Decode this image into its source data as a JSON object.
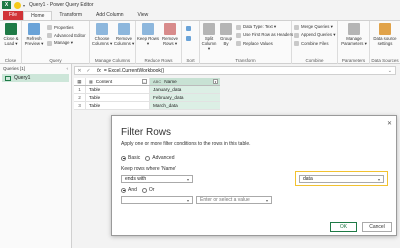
{
  "window": {
    "title": "Query1 - Power Query Editor",
    "app_icon": "X"
  },
  "ribbon_tabs": [
    "File",
    "Home",
    "Transform",
    "Add Column",
    "View"
  ],
  "ribbon": {
    "close": {
      "btn": "Close & Load ▾",
      "group": "Close"
    },
    "query": {
      "refresh": "Refresh Preview ▾",
      "properties": "Properties",
      "advanced": "Advanced Editor",
      "manage": "Manage ▾",
      "group": "Query"
    },
    "manage_columns": {
      "choose": "Choose Columns ▾",
      "remove": "Remove Columns ▾",
      "group": "Manage Columns"
    },
    "reduce_rows": {
      "keep": "Keep Rows ▾",
      "remove": "Remove Rows ▾",
      "group": "Reduce Rows"
    },
    "sort": {
      "group": "Sort"
    },
    "transform": {
      "split": "Split Column ▾",
      "groupby": "Group By",
      "datatype": "Data Type: Text ▾",
      "firstrow": "Use First Row as Headers ▾",
      "replace": "Replace Values",
      "group": "Transform"
    },
    "combine": {
      "merge": "Merge Queries ▾",
      "append": "Append Queries ▾",
      "combinefiles": "Combine Files",
      "group": "Combine"
    },
    "parameters": {
      "manage": "Manage Parameters ▾",
      "group": "Parameters"
    },
    "datasources": {
      "settings": "Data source settings",
      "group": "Data Sources"
    }
  },
  "queries_panel": {
    "header": "Queries [1]",
    "items": [
      "Query1"
    ]
  },
  "formula_bar": {
    "fx": "fx",
    "formula": "= Excel.CurrentWorkbook()"
  },
  "grid": {
    "columns": [
      "Content",
      "Name"
    ],
    "column_types": [
      "▦",
      "ABC"
    ],
    "rows": [
      {
        "n": "1",
        "content": "Table",
        "name": "January_data"
      },
      {
        "n": "2",
        "content": "Table",
        "name": "February_data"
      },
      {
        "n": "3",
        "content": "Table",
        "name": "March_data"
      }
    ]
  },
  "dialog": {
    "title": "Filter Rows",
    "description": "Apply one or more filter conditions to the rows in this table.",
    "mode_basic": "Basic",
    "mode_advanced": "Advanced",
    "keep_label": "Keep rows where 'Name'",
    "operator": "ends with",
    "value": "data",
    "and_label": "And",
    "or_label": "Or",
    "value2_placeholder": "Enter or select a value",
    "ok": "OK",
    "cancel": "Cancel"
  },
  "colors": {
    "accent": "#1e7a46",
    "file_tab": "#d13438",
    "highlight": "#f2c230",
    "selected_col": "#dcefe5"
  }
}
